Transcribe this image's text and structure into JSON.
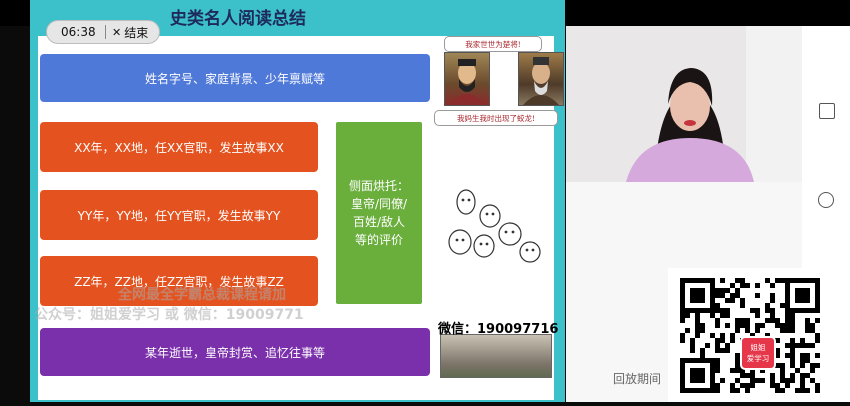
{
  "player": {
    "time": "06:38",
    "end_label": "结束",
    "end_icon": "close-icon"
  },
  "slide": {
    "title": "史类名人阅读总结",
    "rows": {
      "blue": "姓名字号、家庭背景、少年禀赋等",
      "xx": "XX年，XX地，任XX官职，发生故事XX",
      "yy": "YY年，YY地，任YY官职，发生故事YY",
      "zz": "ZZ年，ZZ地，任ZZ官职，发生故事ZZ",
      "purple": "某年逝世，皇帝封赏、追忆往事等"
    },
    "side_box": [
      "侧面烘托：",
      "皇帝/同僚/",
      "百姓/敌人",
      "等的评价"
    ],
    "speech_top": "我家世世为楚将!",
    "speech_bottom": "我妈生我时出现了蛟龙!",
    "watermark_line1": "全网最全学霸总裁课程请加",
    "watermark_line2": "公众号：姐姐爱学习 或 微信：19009771",
    "wechat_text": "微信：190097716",
    "colors": {
      "frame": "#3cc0c9",
      "blue": "#4f79d8",
      "orange": "#e4531f",
      "green": "#6aae3c",
      "purple": "#7a2fab"
    }
  },
  "right_panel": {
    "replay_text": "回放期间"
  },
  "qr": {
    "badge_line1": "姐姐",
    "badge_line2": "爱学习"
  }
}
